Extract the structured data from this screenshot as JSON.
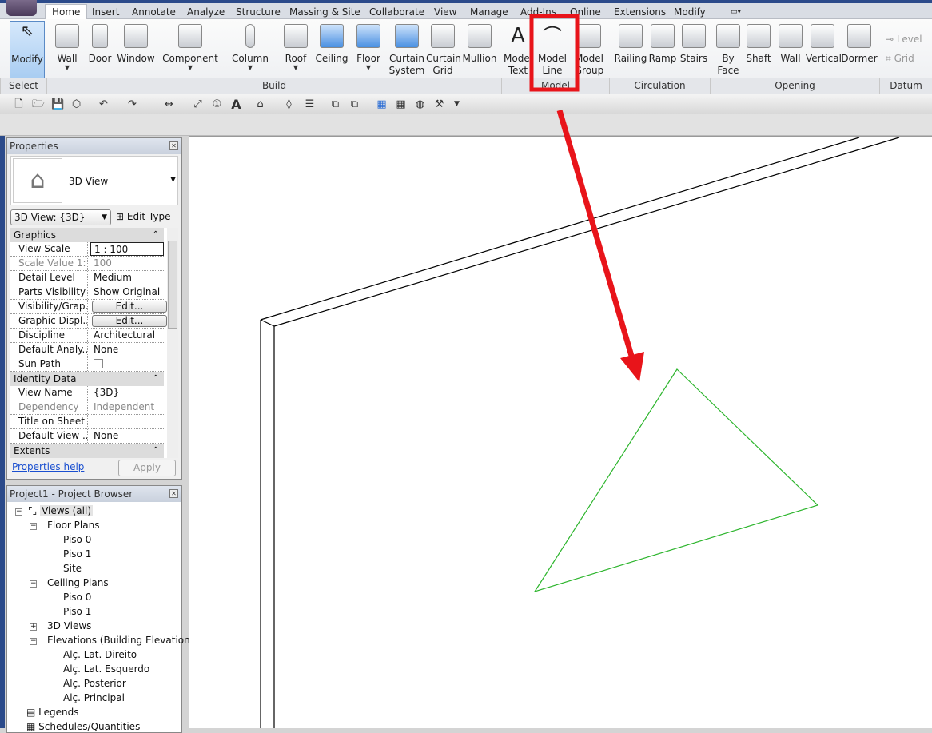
{
  "tabs": [
    "Home",
    "Insert",
    "Annotate",
    "Analyze",
    "Structure",
    "Massing & Site",
    "Collaborate",
    "View",
    "Manage",
    "Add-Ins",
    "Online",
    "Extensions",
    "Modify"
  ],
  "ribbon": {
    "buttons": [
      {
        "label": "Modify",
        "l2": ""
      },
      {
        "label": "Wall",
        "l2": ""
      },
      {
        "label": "Door",
        "l2": ""
      },
      {
        "label": "Window",
        "l2": ""
      },
      {
        "label": "Component",
        "l2": ""
      },
      {
        "label": "Column",
        "l2": ""
      },
      {
        "label": "Roof",
        "l2": ""
      },
      {
        "label": "Ceiling",
        "l2": ""
      },
      {
        "label": "Floor",
        "l2": ""
      },
      {
        "label": "Curtain",
        "l2": "System"
      },
      {
        "label": "Curtain",
        "l2": "Grid"
      },
      {
        "label": "Mullion",
        "l2": ""
      },
      {
        "label": "Model",
        "l2": "Text"
      },
      {
        "label": "Model",
        "l2": "Line"
      },
      {
        "label": "Model",
        "l2": "Group"
      },
      {
        "label": "Railing",
        "l2": ""
      },
      {
        "label": "Ramp",
        "l2": ""
      },
      {
        "label": "Stairs",
        "l2": ""
      },
      {
        "label": "By",
        "l2": "Face"
      },
      {
        "label": "Shaft",
        "l2": ""
      },
      {
        "label": "Wall",
        "l2": ""
      },
      {
        "label": "Vertical",
        "l2": ""
      },
      {
        "label": "Dormer",
        "l2": ""
      }
    ],
    "datum": {
      "level": "Level",
      "grid": "Grid"
    },
    "panels": [
      "Select",
      "Build",
      "Model",
      "Circulation",
      "Opening",
      "Datum"
    ]
  },
  "properties": {
    "title": "Properties",
    "type_name": "3D View",
    "type_selector": "3D View: {3D}",
    "edit_type": "Edit Type",
    "groups": {
      "graphics": "Graphics",
      "identity": "Identity Data",
      "extents": "Extents"
    },
    "rows": [
      {
        "k": "View Scale",
        "v": "1 : 100"
      },
      {
        "k": "Scale Value    1:",
        "v": "100"
      },
      {
        "k": "Detail Level",
        "v": "Medium"
      },
      {
        "k": "Parts Visibility",
        "v": "Show Original"
      },
      {
        "k": "Visibility/Grap...",
        "v": "Edit..."
      },
      {
        "k": "Graphic Displ...",
        "v": "Edit..."
      },
      {
        "k": "Discipline",
        "v": "Architectural"
      },
      {
        "k": "Default Analy...",
        "v": "None"
      },
      {
        "k": "Sun Path",
        "v": ""
      },
      {
        "k": "View Name",
        "v": "{3D}"
      },
      {
        "k": "Dependency",
        "v": "Independent"
      },
      {
        "k": "Title on Sheet",
        "v": ""
      },
      {
        "k": "Default View ...",
        "v": "None"
      }
    ],
    "help": "Properties help",
    "apply": "Apply"
  },
  "browser": {
    "title": "Project1 - Project Browser",
    "items": [
      "Views (all)",
      "Floor Plans",
      "Piso 0",
      "Piso 1",
      "Site",
      "Ceiling Plans",
      "Piso 0",
      "Piso 1",
      "3D Views",
      "Elevations (Building Elevation)",
      "Alç. Lat. Direito",
      "Alç. Lat. Esquerdo",
      "Alç. Posterior",
      "Alç. Principal",
      "Legends",
      "Schedules/Quantities"
    ]
  },
  "colors": {
    "highlight": "#e8141a",
    "model_line": "#2db52d"
  }
}
